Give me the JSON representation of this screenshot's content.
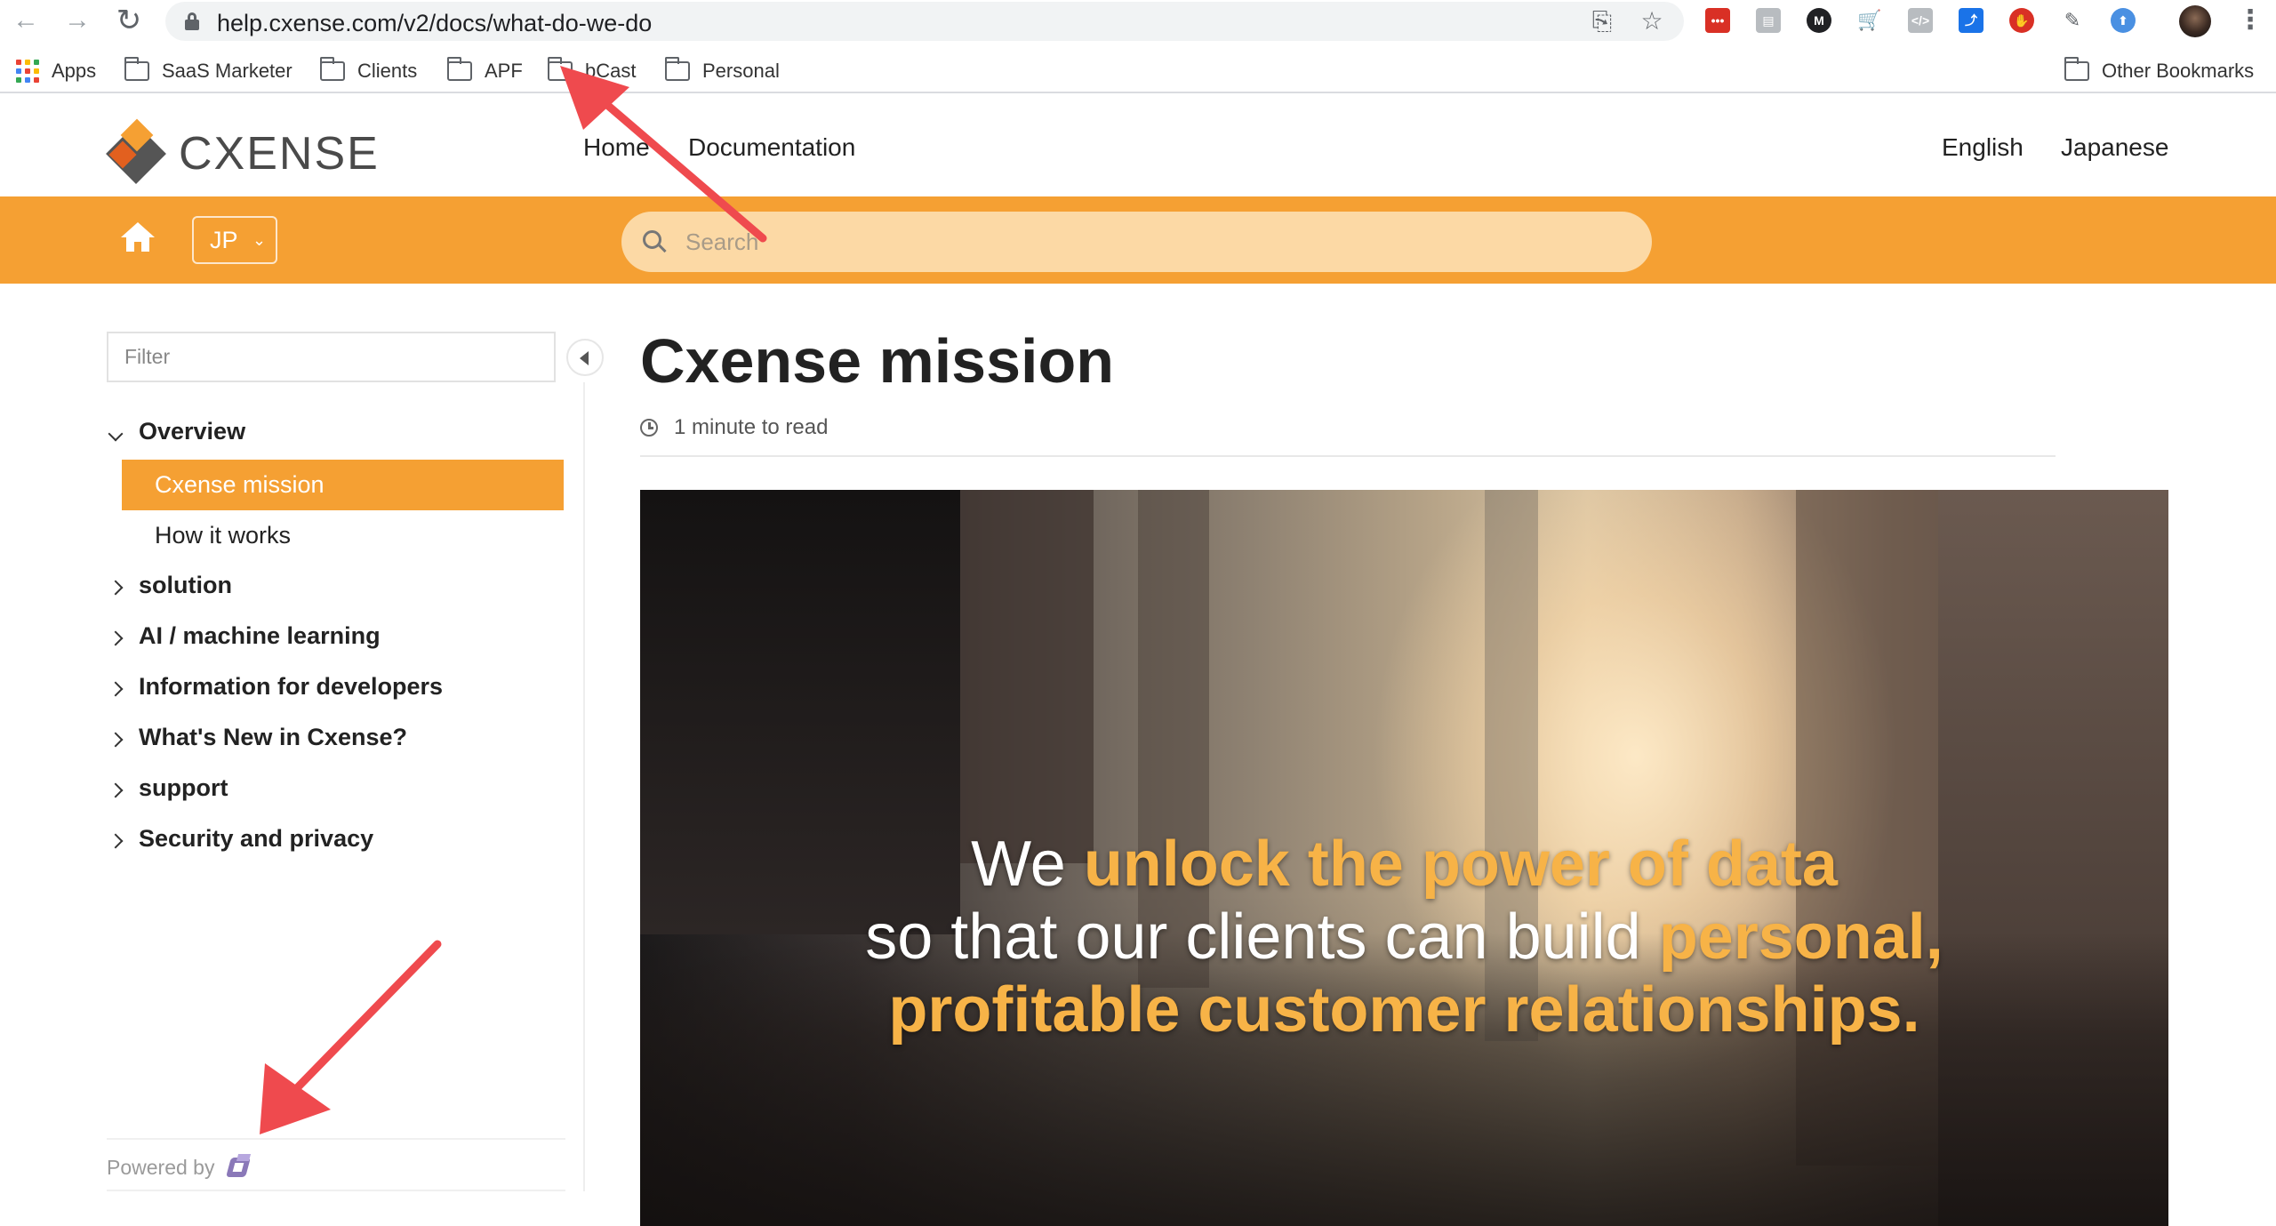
{
  "browser": {
    "url": "help.cxense.com/v2/docs/what-do-we-do",
    "bookmarks": [
      "Apps",
      "SaaS Marketer",
      "Clients",
      "APF",
      "bCast",
      "Personal"
    ],
    "other_bookmarks": "Other Bookmarks",
    "extensions": [
      {
        "name": "ext-red-icon",
        "color": "#d93025"
      },
      {
        "name": "ext-clipboard-icon",
        "color": "#9aa0a6"
      },
      {
        "name": "ext-m-icon",
        "color": "#202124"
      },
      {
        "name": "ext-cart-icon",
        "color": "#d93025"
      },
      {
        "name": "ext-code-icon",
        "color": "#9aa0a6"
      },
      {
        "name": "ext-blue-icon",
        "color": "#1a73e8"
      },
      {
        "name": "ext-stop-icon",
        "color": "#d93025"
      },
      {
        "name": "ext-pen-icon",
        "color": "#5f6368"
      },
      {
        "name": "ext-shield-icon",
        "color": "#4a90e2"
      }
    ]
  },
  "header": {
    "logo_text": "CXENSE",
    "nav_home": "Home",
    "nav_docs": "Documentation",
    "lang_en": "English",
    "lang_jp": "Japanese"
  },
  "toolbar": {
    "lang_select": "JP",
    "search_placeholder": "Search",
    "accent": "#f5a033"
  },
  "sidebar": {
    "filter_placeholder": "Filter",
    "items": [
      {
        "label": "Overview",
        "expanded": true
      },
      {
        "label": "Cxense mission",
        "active": true
      },
      {
        "label": "How it works"
      },
      {
        "label": "solution"
      },
      {
        "label": "AI / machine learning"
      },
      {
        "label": "Information for developers"
      },
      {
        "label": "What's New in Cxense?"
      },
      {
        "label": "support"
      },
      {
        "label": "Security and privacy"
      }
    ],
    "powered_by": "Powered by"
  },
  "main": {
    "title": "Cxense mission",
    "read_time": "1 minute to read",
    "hero": {
      "line1_plain": "We ",
      "line1_highlight": "unlock the power of data",
      "line2_plain": "so that our clients can build ",
      "line2_highlight": "personal,",
      "line3_highlight": "profitable customer relationships."
    }
  }
}
